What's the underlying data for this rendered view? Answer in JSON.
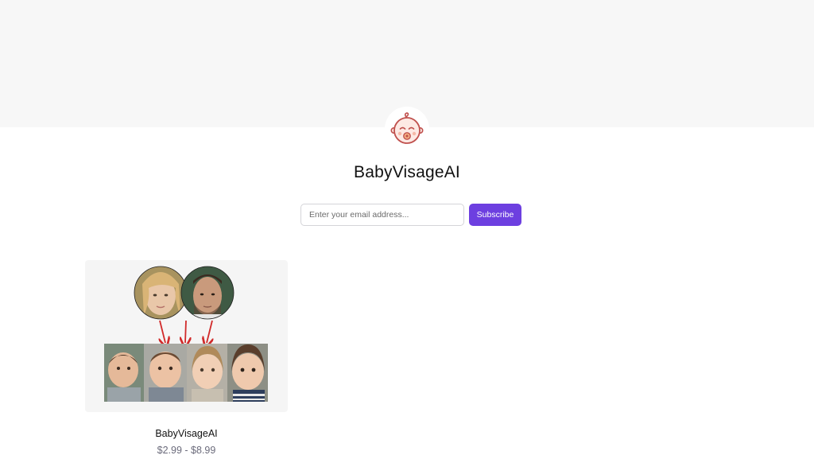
{
  "header": {
    "logo_icon": "baby-face-icon",
    "shop_name": "BabyVisageAI",
    "banner_color": "#f7f7f7"
  },
  "subscribe": {
    "email_placeholder": "Enter your email address...",
    "email_value": "",
    "button_label": "Subscribe",
    "button_color": "#6d3fe0"
  },
  "products": [
    {
      "name": "BabyVisageAI",
      "price": "$2.99 - $8.99",
      "image_icon": "parents-to-baby-faces-image"
    }
  ]
}
